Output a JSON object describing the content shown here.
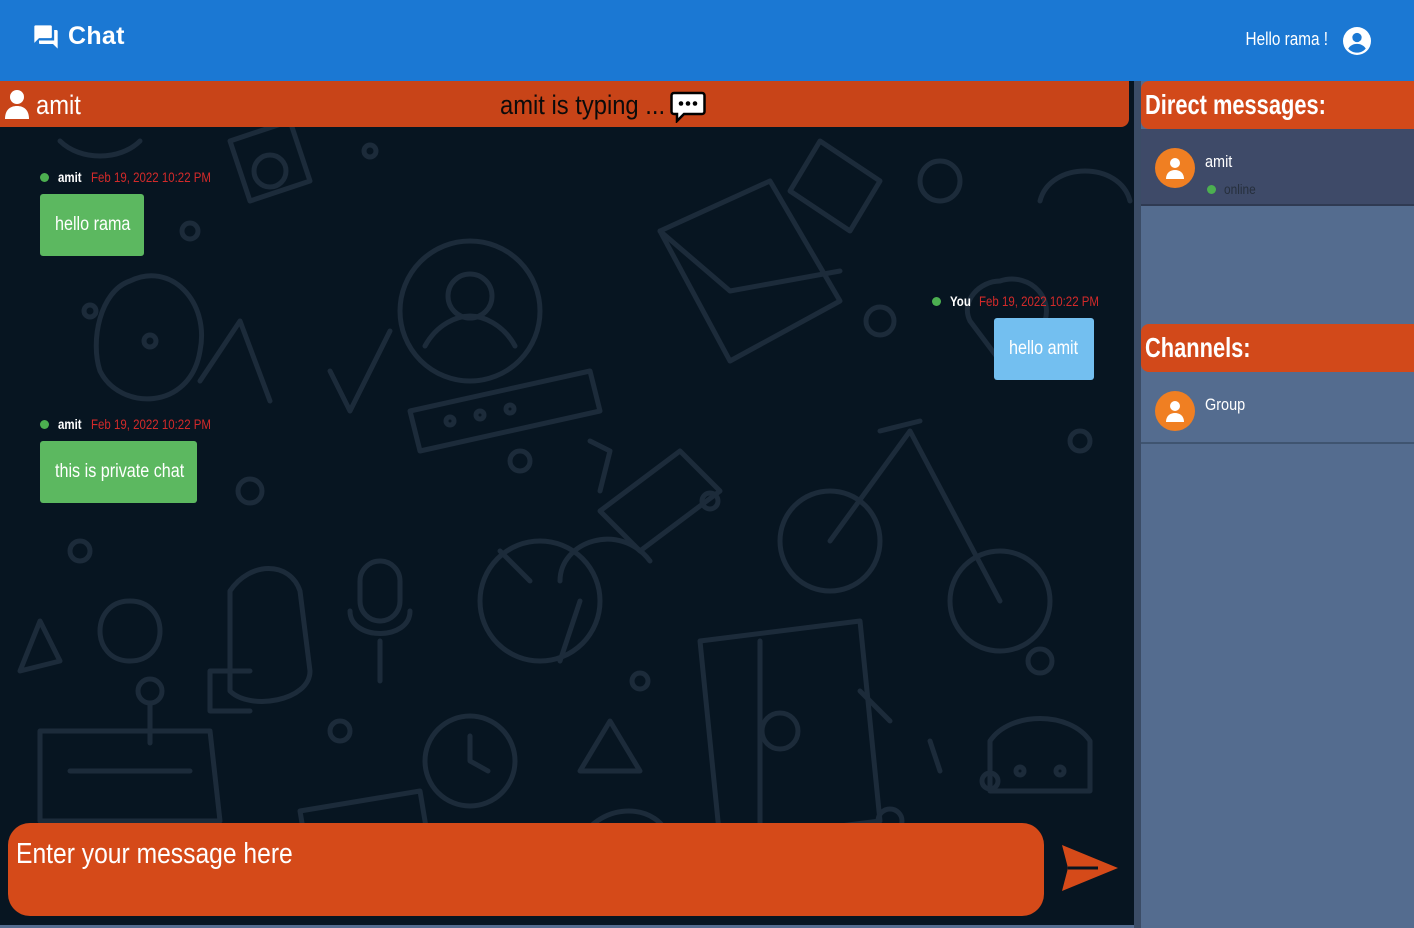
{
  "header": {
    "app_title": "Chat",
    "greeting": "Hello rama !"
  },
  "conversation": {
    "peer_name": "amit",
    "typing_status": "amit is typing ...",
    "messages": [
      {
        "sender": "amit",
        "timestamp": "Feb 19, 2022 10:22 PM",
        "text": "hello rama",
        "direction": "incoming"
      },
      {
        "sender": "You",
        "timestamp": "Feb 19, 2022 10:22 PM",
        "text": "hello amit",
        "direction": "outgoing"
      },
      {
        "sender": "amit",
        "timestamp": "Feb 19, 2022 10:22 PM",
        "text": "this is private chat",
        "direction": "incoming"
      }
    ]
  },
  "composer": {
    "placeholder": "Enter your message here",
    "value": ""
  },
  "sidebar": {
    "direct_messages_title": "Direct messages:",
    "direct_messages": [
      {
        "name": "amit",
        "status": "online"
      }
    ],
    "channels_title": "Channels:",
    "channels": [
      {
        "name": "Group"
      }
    ]
  },
  "colors": {
    "header_blue": "#1b78d3",
    "accent_orange": "#d2491a",
    "incoming_bubble": "#5cb860",
    "outgoing_bubble": "#73bff0",
    "timestamp_red": "#d22a2a",
    "chat_background": "#071521",
    "sidebar_background": "#546c8f"
  },
  "icons": {
    "brand": "forum-icon",
    "account": "account-circle-icon",
    "peer": "person-icon",
    "typing": "speech-bubble-dots-icon",
    "send": "send-arrow-icon"
  }
}
